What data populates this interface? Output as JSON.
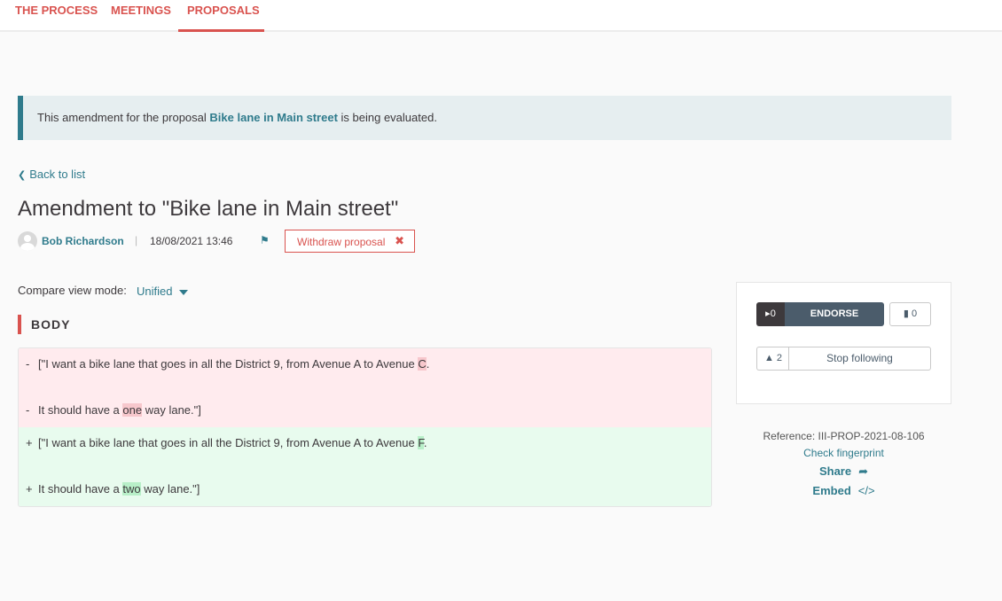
{
  "nav": {
    "tabs": [
      {
        "label": "THE PROCESS",
        "active": false
      },
      {
        "label": "MEETINGS",
        "active": false
      },
      {
        "label": "PROPOSALS",
        "active": true
      }
    ]
  },
  "callout": {
    "prefix": "This amendment for the proposal",
    "link": "Bike lane in Main street",
    "suffix": "is being evaluated."
  },
  "back_link": "Back to list",
  "title": "Amendment to \"Bike lane in Main street\"",
  "author": {
    "name": "Bob Richardson",
    "separator": "|",
    "date": "18/08/2021 13:46",
    "withdraw_label": "Withdraw proposal"
  },
  "compare": {
    "label": "Compare view mode:",
    "value": "Unified"
  },
  "section": {
    "title": "BODY"
  },
  "diff": {
    "removed": [
      {
        "sign": "-",
        "before": "[\"I want a bike lane that goes in all the District 9, from Avenue A to Avenue ",
        "highlight": "C",
        "after": "."
      },
      {
        "sign": "-",
        "before": "It should have a ",
        "highlight": "one",
        "after": " way lane.\"]"
      }
    ],
    "added": [
      {
        "sign": "+",
        "before": "[\"I want a bike lane that goes in all the District 9, from Avenue A to Avenue ",
        "highlight": "F",
        "after": "."
      },
      {
        "sign": "+",
        "before": "It should have a ",
        "highlight": "two",
        "after": " way lane.\"]"
      }
    ]
  },
  "card": {
    "endorse_count": "0",
    "endorse_label": "ENDORSE",
    "comments_count": "0",
    "followers_count": "2",
    "follow_label": "Stop following"
  },
  "meta": {
    "reference": "Reference: III-PROP-2021-08-106",
    "fingerprint": "Check fingerprint",
    "share": "Share",
    "embed": "Embed"
  },
  "colors": {
    "accent": "#d9534f",
    "link": "#2f7b8c",
    "removed_bg": "#ffebee",
    "added_bg": "#e8fbee"
  }
}
